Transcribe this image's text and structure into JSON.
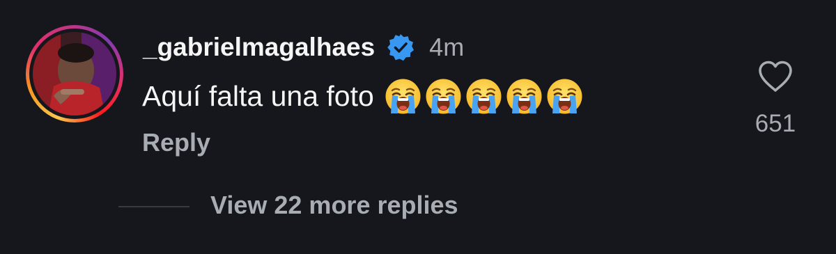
{
  "comment": {
    "username": "_gabrielmagalhaes",
    "verified_icon": "verified-badge-icon",
    "time": "4m",
    "text": "Aquí falta una foto",
    "emoji_name": "loudly-crying-face",
    "emoji_count": 5,
    "reply_label": "Reply",
    "like_icon": "heart-outline-icon",
    "likes": "651",
    "view_replies_label": "View 22 more replies"
  },
  "colors": {
    "background": "#16171c",
    "primary_text": "#f5f5f5",
    "secondary_text": "#a8acb3",
    "verified_blue": "#3897f0"
  }
}
